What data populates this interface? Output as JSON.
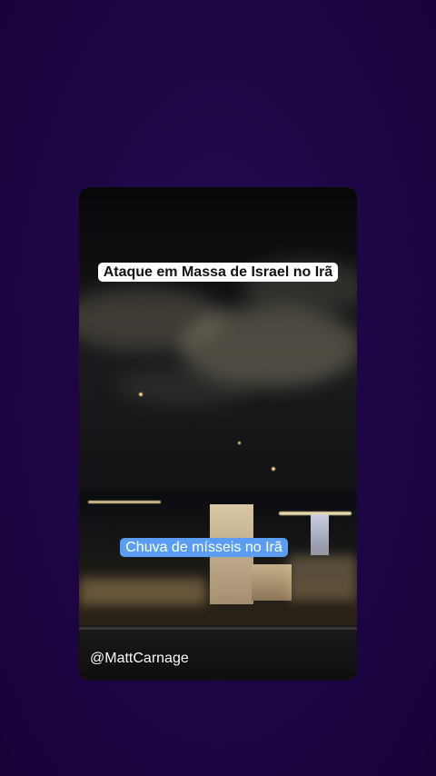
{
  "colors": {
    "background": "#1f0648",
    "caption_top_bg": "#ffffff",
    "caption_bottom_bg": "#5b9df2"
  },
  "caption_top": "Ataque em Massa de Israel no Irã",
  "caption_bottom": "Chuva de mísseis no Irã",
  "watermark": "@MattCarnage"
}
